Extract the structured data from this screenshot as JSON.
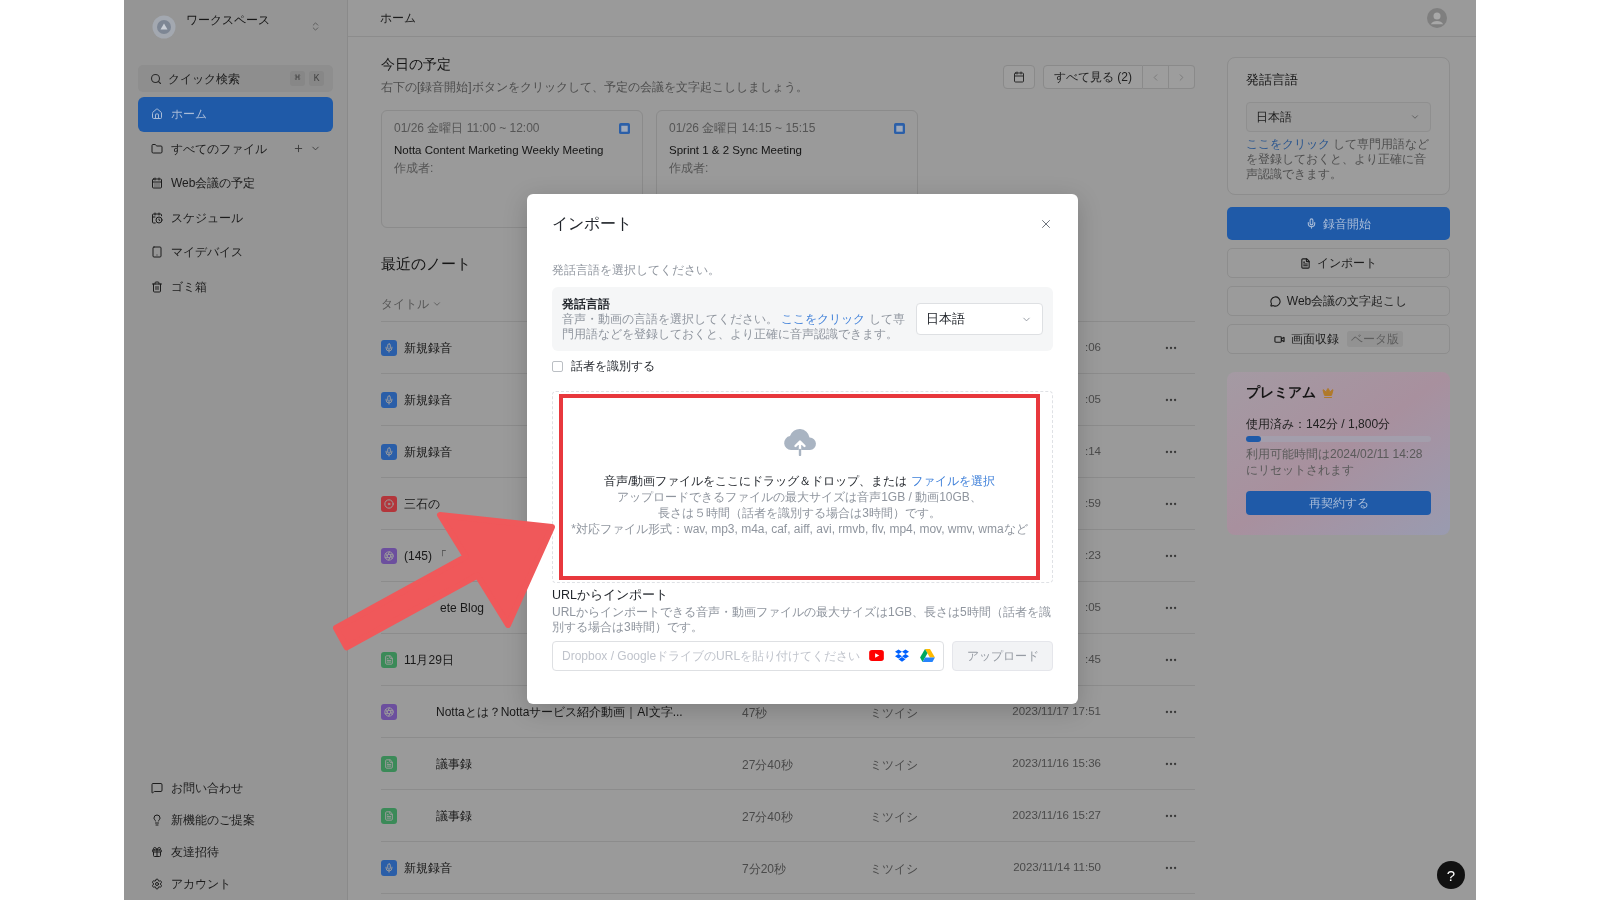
{
  "sidebar": {
    "workspace": {
      "name": "ワークスペース"
    },
    "quick_search": {
      "label": "クイック検索",
      "keys": [
        "⌘",
        "K"
      ]
    },
    "nav": [
      {
        "label": "ホーム",
        "selected": true,
        "expandable": false
      },
      {
        "label": "すべてのファイル",
        "selected": false,
        "expandable": true
      },
      {
        "label": "Web会議の予定",
        "selected": false,
        "expandable": false
      },
      {
        "label": "スケジュール",
        "selected": false,
        "expandable": false
      },
      {
        "label": "マイデバイス",
        "selected": false,
        "expandable": false
      },
      {
        "label": "ゴミ箱",
        "selected": false,
        "expandable": false
      }
    ],
    "footer": [
      {
        "label": "お問い合わせ"
      },
      {
        "label": "新機能のご提案"
      },
      {
        "label": "友達招待"
      },
      {
        "label": "アカウント"
      }
    ]
  },
  "header": {
    "breadcrumb": "ホーム"
  },
  "schedule": {
    "title": "今日の予定",
    "subtitle": "右下の[録音開始]ボタンをクリックして、予定の会議を文字起こししましょう。",
    "view_all": "すべて見る (2)",
    "meetings": [
      {
        "time": "01/26 金曜日 11:00 ~ 12:00",
        "title": "Notta Content Marketing Weekly Meeting",
        "author": "作成者:"
      },
      {
        "time": "01/26 金曜日 14:15 ~ 15:15",
        "title": "Sprint 1 & 2 Sync Meeting",
        "author": "作成者:"
      }
    ]
  },
  "recent_notes": {
    "title": "最近のノート",
    "column": "タイトル",
    "rows": [
      {
        "kind": "recording",
        "color": "#2a5ea8",
        "title": "新規録音",
        "inset": false,
        "covered_start": false,
        "date": ":06"
      },
      {
        "kind": "recording",
        "color": "#2a5ea8",
        "title": "新規録音",
        "inset": false,
        "covered_start": false,
        "date": ":05"
      },
      {
        "kind": "recording",
        "color": "#2a5ea8",
        "title": "新規録音",
        "inset": false,
        "covered_start": false,
        "date": ":14"
      },
      {
        "kind": "meeting",
        "color": "#b3363b",
        "title": "三石の",
        "inset": false,
        "covered_start": false,
        "date": ":59"
      },
      {
        "kind": "video",
        "color": "#6c4f9e",
        "title": "(145) 「",
        "inset": false,
        "covered_start": false,
        "date": ":23"
      },
      {
        "title": "ete Blog",
        "inset": false,
        "covered_start": true,
        "date": ":05"
      },
      {
        "kind": "note",
        "color": "#3b8a58",
        "title": "11月29日",
        "inset": false,
        "covered_start": false,
        "date": ":45"
      },
      {
        "kind": "video",
        "color": "#6c4f9e",
        "title": "Nottaとは？Nottaサービス紹介動画｜AI文字...",
        "inset": true,
        "covered_start": false,
        "duration": "47秒",
        "owner": "ミツイシ",
        "date": "2023/11/17 17:51"
      },
      {
        "kind": "note",
        "color": "#3b8a58",
        "title": "議事録",
        "inset": true,
        "covered_start": false,
        "duration": "27分40秒",
        "owner": "ミツイシ",
        "date": "2023/11/16 15:36"
      },
      {
        "kind": "note",
        "color": "#3b8a58",
        "title": "議事録",
        "inset": true,
        "covered_start": false,
        "duration": "27分40秒",
        "owner": "ミツイシ",
        "date": "2023/11/16 15:27"
      },
      {
        "kind": "recording",
        "color": "#2a5ea8",
        "title": "新規録音",
        "inset": false,
        "covered_start": false,
        "duration": "7分20秒",
        "owner": "ミツイシ",
        "date": "2023/11/14 11:50"
      }
    ]
  },
  "language_card": {
    "title": "発話言語",
    "select": "日本語",
    "link": "ここをクリック",
    "text": "して専門用語などを登録しておくと、より正確に音声認識できます。"
  },
  "actions": [
    {
      "kind": "primary",
      "label": "録音開始"
    },
    {
      "kind": "secondary",
      "label": "インポート"
    },
    {
      "kind": "secondary",
      "label": "Web会議の文字起こし"
    },
    {
      "kind": "secondary",
      "label": "画面収録",
      "badge": "ベータ版"
    }
  ],
  "premium": {
    "title": "プレミアム",
    "usage": "使用済み：142分 / 1,800分",
    "level": 0.079,
    "note": "利用可能時間は2024/02/11 14:28にリセットされます",
    "button": "再契約する"
  },
  "import_dialog": {
    "title": "インポート",
    "prompt": "発話言語を選択してください。",
    "language": {
      "label": "発話言語",
      "description_before": "音声・動画の言語を選択してください。",
      "link": "ここをクリック",
      "description_after": "して専門用語などを登録しておくと、より正確に音声認識できます。",
      "select": "日本語"
    },
    "speaker_option": {
      "label": "話者を識別する",
      "checked": false
    },
    "drop_zone": {
      "text": "音声/動画ファイルをここにドラッグ＆ドロップ、または",
      "link": "ファイルを選択",
      "notes": [
        "アップロードできるファイルの最大サイズは音声1GB / 動画10GB、",
        "長さは５時間（話者を識別する場合は3時間）です。",
        "*対応ファイル形式：wav, mp3, m4a, caf, aiff, avi, rmvb, flv, mp4, mov, wmv, wmaなど"
      ]
    },
    "url_import": {
      "title": "URLからインポート",
      "description": "URLからインポートできる音声・動画ファイルの最大サイズは1GB、長さは5時間（話者を識別する場合は3時間）です。",
      "placeholder": "Dropbox / GoogleドライブのURLを貼り付けてください",
      "button": {
        "label": "アップロード",
        "disabled": true
      }
    }
  },
  "help_button": "?"
}
